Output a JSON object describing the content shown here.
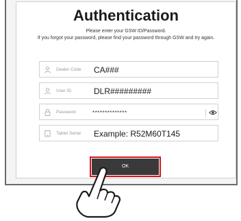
{
  "dialog": {
    "title": "Authentication",
    "instructions": [
      "Please enter your GSW ID/Password.",
      "If you forgot your password, please find your password through GSW and try again."
    ]
  },
  "fields": [
    {
      "icon": "person-icon",
      "label": "Dealer Code",
      "value": "CA###"
    },
    {
      "icon": "person-icon",
      "label": "User ID",
      "value": "DLR#########"
    },
    {
      "icon": "lock-icon",
      "label": "Password",
      "value": "**************",
      "toggle_icon": "eye-icon"
    },
    {
      "icon": "tablet-icon",
      "label": "Tablet Serial",
      "value": "Example: R52M60T145"
    }
  ],
  "ok_button": {
    "label": "OK",
    "highlight_color": "#d4141c"
  },
  "hand_icon": "pointing-hand-icon"
}
